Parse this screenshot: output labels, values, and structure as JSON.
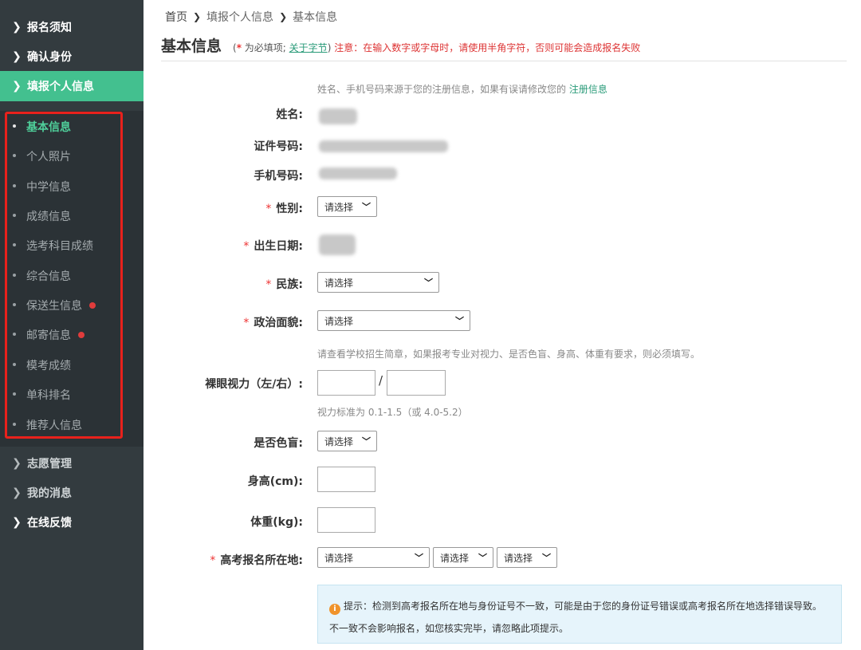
{
  "sidebar": {
    "top_items": [
      {
        "label": "报名须知",
        "icon": "chevron-right-icon"
      },
      {
        "label": "确认身份",
        "icon": "chevron-right-icon"
      },
      {
        "label": "填报个人信息",
        "icon": "chevron-right-icon",
        "active": true
      }
    ],
    "sub_items": [
      {
        "label": "基本信息",
        "current": true,
        "alert": false
      },
      {
        "label": "个人照片",
        "current": false,
        "alert": false
      },
      {
        "label": "中学信息",
        "current": false,
        "alert": false
      },
      {
        "label": "成绩信息",
        "current": false,
        "alert": false
      },
      {
        "label": "选考科目成绩",
        "current": false,
        "alert": false
      },
      {
        "label": "综合信息",
        "current": false,
        "alert": false
      },
      {
        "label": "保送生信息",
        "current": false,
        "alert": true
      },
      {
        "label": "邮寄信息",
        "current": false,
        "alert": true
      },
      {
        "label": "模考成绩",
        "current": false,
        "alert": false
      },
      {
        "label": "单科排名",
        "current": false,
        "alert": false
      },
      {
        "label": "推荐人信息",
        "current": false,
        "alert": false
      }
    ],
    "bottom_items": [
      {
        "label": "志愿管理",
        "icon": "chevron-right-icon",
        "muted": true
      },
      {
        "label": "我的消息",
        "icon": "chevron-right-icon",
        "muted": true
      },
      {
        "label": "在线反馈",
        "icon": "chevron-right-icon",
        "muted": false
      }
    ]
  },
  "breadcrumb": {
    "home": "首页",
    "level2": "填报个人信息",
    "level3": "基本信息",
    "separator": "❯"
  },
  "header": {
    "title": "基本信息",
    "note_open": "(",
    "note_star": "*",
    "note_required": " 为必填项; ",
    "note_link": "关于字节",
    "note_close": ")",
    "note_warning": " 注意：在输入数字或字母时，请使用半角字符，否则可能会造成报名失败"
  },
  "form": {
    "source_hint": "姓名、手机号码来源于您的注册信息，如果有误请修改您的 ",
    "source_hint_link": "注册信息",
    "name_label": "姓名:",
    "id_label": "证件号码:",
    "phone_label": "手机号码:",
    "gender_label": "性别:",
    "gender_value": "请选择",
    "birth_label": "出生日期:",
    "ethnicity_label": "民族:",
    "ethnicity_value": "请选择",
    "political_label": "政治面貌:",
    "political_value": "请选择",
    "vision_hint": "请查看学校招生简章，如果报考专业对视力、是否色盲、身高、体重有要求，则必须填写。",
    "vision_label": "裸眼视力（左/右）:",
    "vision_slash": "/",
    "vision_left": "",
    "vision_right": "",
    "vision_standard": "视力标准为 0.1-1.5（或 4.0-5.2）",
    "colorblind_label": "是否色盲:",
    "colorblind_value": "请选择",
    "height_label": "身高(cm):",
    "height_value": "",
    "weight_label": "体重(kg):",
    "weight_value": "",
    "location_label": "高考报名所在地:",
    "location_province": "请选择",
    "location_city": "请选择",
    "location_district": "请选择",
    "required_mark": "*"
  },
  "tip": {
    "icon": "info-icon",
    "text": "提示：检测到高考报名所在地与身份证号不一致，可能是由于您的身份证号错误或高考报名所在地选择错误导致。不一致不会影响报名，如您核实完毕，请忽略此项提示。"
  },
  "colors": {
    "sidebar_bg": "#333b3f",
    "active_green": "#43c08f",
    "highlight_red": "#e8211c",
    "link_teal": "#2a9b79",
    "required_red": "#e33333"
  }
}
